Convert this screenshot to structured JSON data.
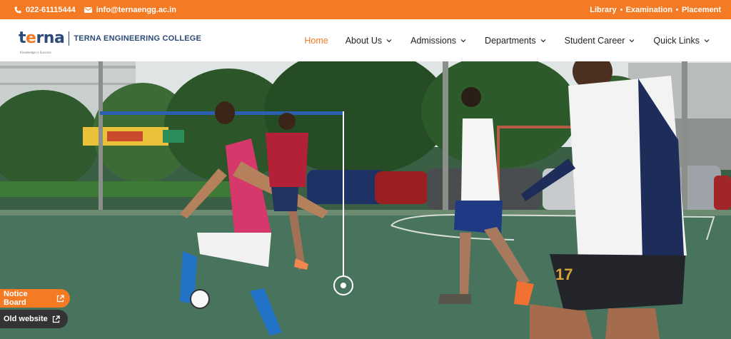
{
  "topbar": {
    "phone": "022-61115444",
    "email": "info@ternaengg.ac.in",
    "links": [
      "Library",
      "Examination",
      "Placement"
    ],
    "colors": {
      "accent": "#f47a24"
    }
  },
  "header": {
    "logo_mark_prefix": "t",
    "logo_mark_o": "e",
    "logo_mark_suffix": "rna",
    "logo_tagline": "Knowledge is Success",
    "college_name": "TERNA ENGINEERING COLLEGE",
    "nav": [
      {
        "label": "Home",
        "active": true,
        "dropdown": false
      },
      {
        "label": "About Us",
        "active": false,
        "dropdown": true
      },
      {
        "label": "Admissions",
        "active": false,
        "dropdown": true
      },
      {
        "label": "Departments",
        "active": false,
        "dropdown": true
      },
      {
        "label": "Student Career",
        "active": false,
        "dropdown": true
      },
      {
        "label": "Quick Links",
        "active": false,
        "dropdown": true
      }
    ]
  },
  "hero": {
    "image": "students-playing-football",
    "player_number": "17"
  },
  "floating": {
    "notice_board": "Notice Board",
    "old_website": "Old website"
  }
}
